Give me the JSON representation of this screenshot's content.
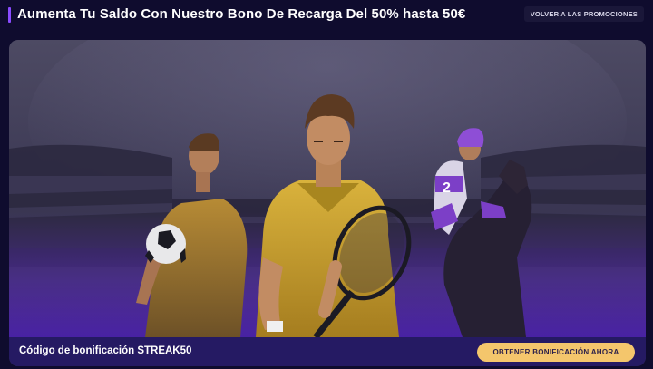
{
  "header": {
    "title": "Aumenta Tu Saldo Con Nuestro Bono De Recarga Del 50% hasta 50€",
    "back_label": "VOLVER A LAS PROMOCIONES"
  },
  "promo": {
    "code_label": "Código de bonificación STREAK50",
    "cta_label": "OBTENER BONIFICACIÓN AHORA",
    "jockey_number": "2"
  },
  "colors": {
    "background": "#0f0c2e",
    "accent": "#8a4bff",
    "cta": "#f4c66c",
    "footer": "#251a63"
  }
}
